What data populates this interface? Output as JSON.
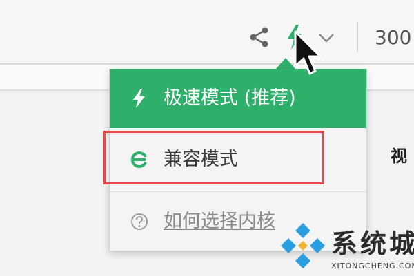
{
  "toolbar": {
    "share_icon": "share-icon",
    "mode_icon": "lightning-icon",
    "dropdown_icon": "chevron-down-icon",
    "zoom_text": "300"
  },
  "side_text": "视",
  "dropdown": {
    "accent_color": "#2fb06a",
    "items": [
      {
        "label": "极速模式 (推荐)",
        "icon": "lightning-icon"
      },
      {
        "label": "兼容模式",
        "icon": "ie-icon"
      },
      {
        "label": "如何选择内核",
        "icon": "help-circle-icon"
      }
    ]
  },
  "highlight": {
    "color": "#e84a4a"
  },
  "watermark": {
    "title": "系统城",
    "subtitle": "XITONGCHENG.COM"
  }
}
